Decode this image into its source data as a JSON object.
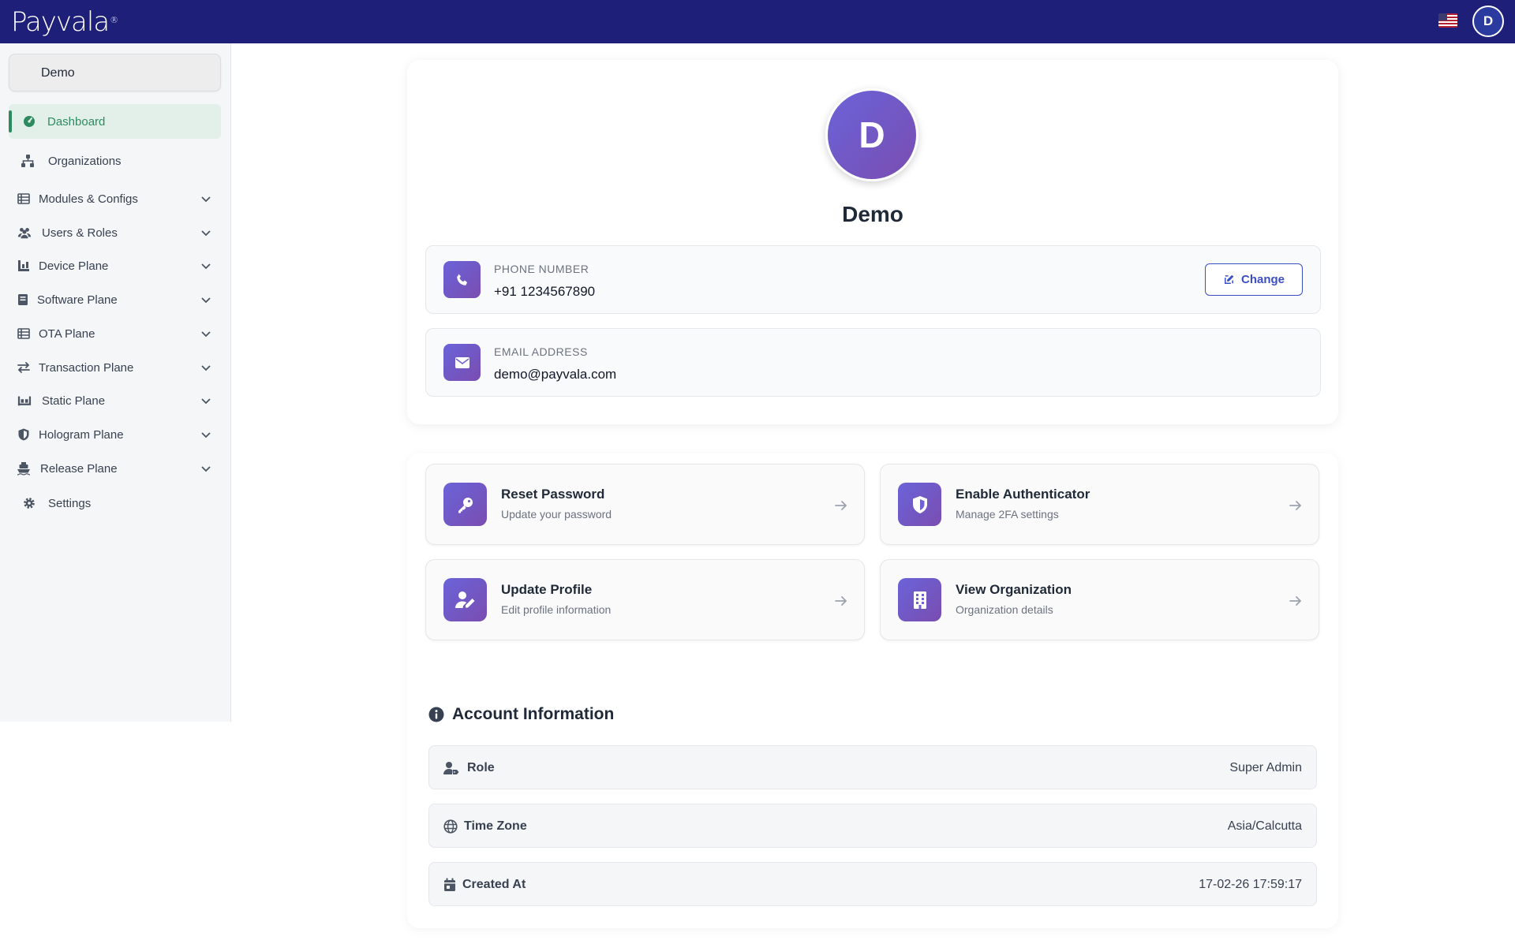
{
  "header": {
    "logo_text": "Payvala",
    "logo_mark": "®",
    "language_flag": "us-flag-icon",
    "user_initial": "D"
  },
  "sidebar": {
    "org_selector": "Demo",
    "items": [
      {
        "label": "Dashboard",
        "icon": "dashboard-icon",
        "active": true,
        "expandable": false
      },
      {
        "label": "Organizations",
        "icon": "sitemap-icon",
        "active": false,
        "expandable": false
      },
      {
        "label": "Modules & Configs",
        "icon": "table-icon",
        "active": false,
        "expandable": true
      },
      {
        "label": "Users & Roles",
        "icon": "users-icon",
        "active": false,
        "expandable": true
      },
      {
        "label": "Device Plane",
        "icon": "device-icon",
        "active": false,
        "expandable": true
      },
      {
        "label": "Software Plane",
        "icon": "software-icon",
        "active": false,
        "expandable": true
      },
      {
        "label": "OTA Plane",
        "icon": "table-icon",
        "active": false,
        "expandable": true
      },
      {
        "label": "Transaction Plane",
        "icon": "exchange-icon",
        "active": false,
        "expandable": true
      },
      {
        "label": "Static Plane",
        "icon": "static-icon",
        "active": false,
        "expandable": true
      },
      {
        "label": "Hologram Plane",
        "icon": "shield-icon",
        "active": false,
        "expandable": true
      },
      {
        "label": "Release Plane",
        "icon": "ship-icon",
        "active": false,
        "expandable": true
      },
      {
        "label": "Settings",
        "icon": "gear-icon",
        "active": false,
        "expandable": false
      }
    ]
  },
  "profile": {
    "initial": "D",
    "name": "Demo",
    "phone_label": "PHONE NUMBER",
    "phone_value": "+91 1234567890",
    "change_label": "Change",
    "email_label": "EMAIL ADDRESS",
    "email_value": "demo@payvala.com"
  },
  "actions": [
    {
      "title": "Reset Password",
      "subtitle": "Update your password",
      "icon": "key-icon"
    },
    {
      "title": "Enable Authenticator",
      "subtitle": "Manage 2FA settings",
      "icon": "shield-icon"
    },
    {
      "title": "Update Profile",
      "subtitle": "Edit profile information",
      "icon": "user-edit-icon"
    },
    {
      "title": "View Organization",
      "subtitle": "Organization details",
      "icon": "building-icon"
    }
  ],
  "account": {
    "title": "Account Information",
    "rows": [
      {
        "label": "Role",
        "value": "Super Admin",
        "icon": "user-tag-icon"
      },
      {
        "label": "Time Zone",
        "value": "Asia/Calcutta",
        "icon": "globe-icon"
      },
      {
        "label": "Created At",
        "value": "17-02-26 17:59:17",
        "icon": "calendar-icon"
      }
    ]
  },
  "colors": {
    "topbar": "#1e1f78",
    "accent_green": "#2e8b5f",
    "icon_gradient_start": "#6a63d9",
    "icon_gradient_end": "#7a4db0",
    "button_blue": "#3b4ec4"
  }
}
